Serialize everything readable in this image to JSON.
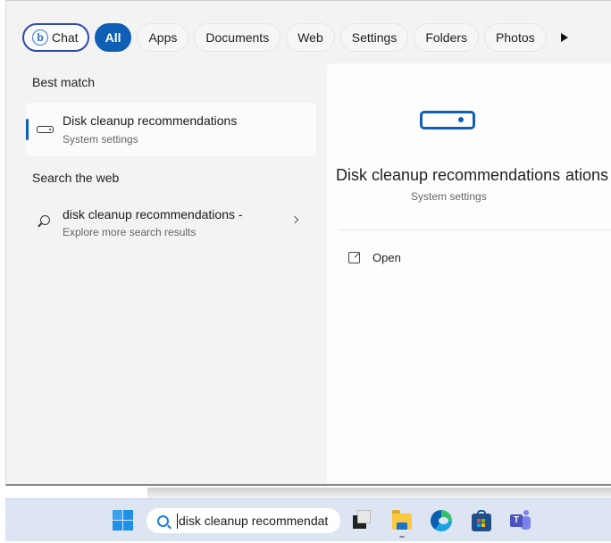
{
  "filters": {
    "chat": "Chat",
    "chat_icon": "bing-chat-icon",
    "items": [
      "All",
      "Apps",
      "Documents",
      "Web",
      "Settings",
      "Folders",
      "Photos"
    ],
    "active": "All",
    "more_icon": "play-arrow-icon"
  },
  "best_match": {
    "heading": "Best match",
    "title": "Disk cleanup recommendations",
    "subtitle": "System settings",
    "icon": "drive-icon"
  },
  "web": {
    "heading": "Search the web",
    "title": "disk cleanup recommendations -",
    "subtitle": "Explore more search results",
    "icon": "search-icon"
  },
  "preview": {
    "title": "Disk cleanup recommendations",
    "title_overlap": "ations",
    "subtitle": "System settings",
    "actions": [
      {
        "label": "Open",
        "icon": "open-external-icon"
      }
    ]
  },
  "taskbar": {
    "search_value": "disk cleanup recommendat",
    "apps": [
      "Task View",
      "File Explorer",
      "Microsoft Edge",
      "Microsoft Store",
      "Microsoft Teams"
    ]
  },
  "colors": {
    "accent": "#0f5fb4",
    "chat_border": "#2e4aa8",
    "taskbar": "#dde5f3"
  }
}
